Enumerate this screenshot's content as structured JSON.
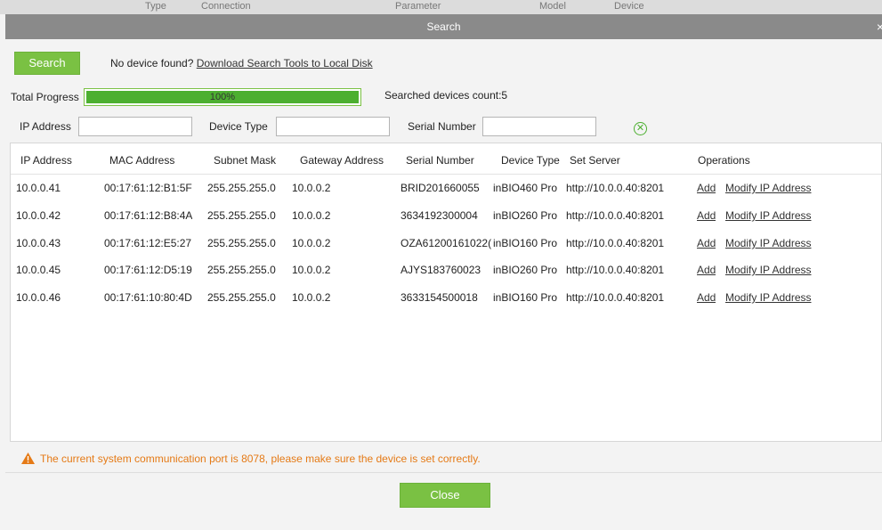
{
  "background_header": [
    "Type",
    "Connection",
    "Parameter",
    "Model",
    "Device"
  ],
  "dialog": {
    "title": "Search",
    "close_glyph": "×"
  },
  "toolbar": {
    "search_label": "Search",
    "no_device_text": "No device found?",
    "download_link": "Download Search Tools to Local Disk"
  },
  "progress": {
    "label": "Total Progress",
    "value_text": "100%",
    "value": 1.0,
    "searched_count_text": "Searched devices count:5"
  },
  "filters": {
    "ip_label": "IP Address",
    "device_type_label": "Device Type",
    "serial_label": "Serial Number",
    "ip_value": "",
    "device_type_value": "",
    "serial_value": "",
    "clear_icon": "clear-circle-icon"
  },
  "table": {
    "columns": [
      "IP Address",
      "MAC Address",
      "Subnet Mask",
      "Gateway Address",
      "Serial Number",
      "Device Type",
      "Set Server",
      "Operations"
    ],
    "rows": [
      {
        "ip": "10.0.0.41",
        "mac": "00:17:61:12:B1:5F",
        "mask": "255.255.255.0",
        "gateway": "10.0.0.2",
        "serial": "BRID201660055",
        "type": "inBIO460 Pro",
        "server": "http://10.0.0.40:8201",
        "add": "Add",
        "modify": "Modify IP Address"
      },
      {
        "ip": "10.0.0.42",
        "mac": "00:17:61:12:B8:4A",
        "mask": "255.255.255.0",
        "gateway": "10.0.0.2",
        "serial": "3634192300004",
        "type": "inBIO260 Pro",
        "server": "http://10.0.0.40:8201",
        "add": "Add",
        "modify": "Modify IP Address"
      },
      {
        "ip": "10.0.0.43",
        "mac": "00:17:61:12:E5:27",
        "mask": "255.255.255.0",
        "gateway": "10.0.0.2",
        "serial": "OZA61200161022(",
        "type": "inBIO160 Pro",
        "server": "http://10.0.0.40:8201",
        "add": "Add",
        "modify": "Modify IP Address"
      },
      {
        "ip": "10.0.0.45",
        "mac": "00:17:61:12:D5:19",
        "mask": "255.255.255.0",
        "gateway": "10.0.0.2",
        "serial": "AJYS183760023",
        "type": "inBIO260 Pro",
        "server": "http://10.0.0.40:8201",
        "add": "Add",
        "modify": "Modify IP Address"
      },
      {
        "ip": "10.0.0.46",
        "mac": "00:17:61:10:80:4D",
        "mask": "255.255.255.0",
        "gateway": "10.0.0.2",
        "serial": "3633154500018",
        "type": "inBIO160 Pro",
        "server": "http://10.0.0.40:8201",
        "add": "Add",
        "modify": "Modify IP Address"
      }
    ]
  },
  "warning": {
    "icon": "warning-triangle-icon",
    "text": "The current system communication port is 8078, please make sure the device is set correctly."
  },
  "footer": {
    "close_label": "Close"
  },
  "colors": {
    "accent_green": "#7ac143",
    "progress_green": "#4caf30",
    "title_bar": "#8a8a8a",
    "warning_orange": "#e57a16"
  }
}
